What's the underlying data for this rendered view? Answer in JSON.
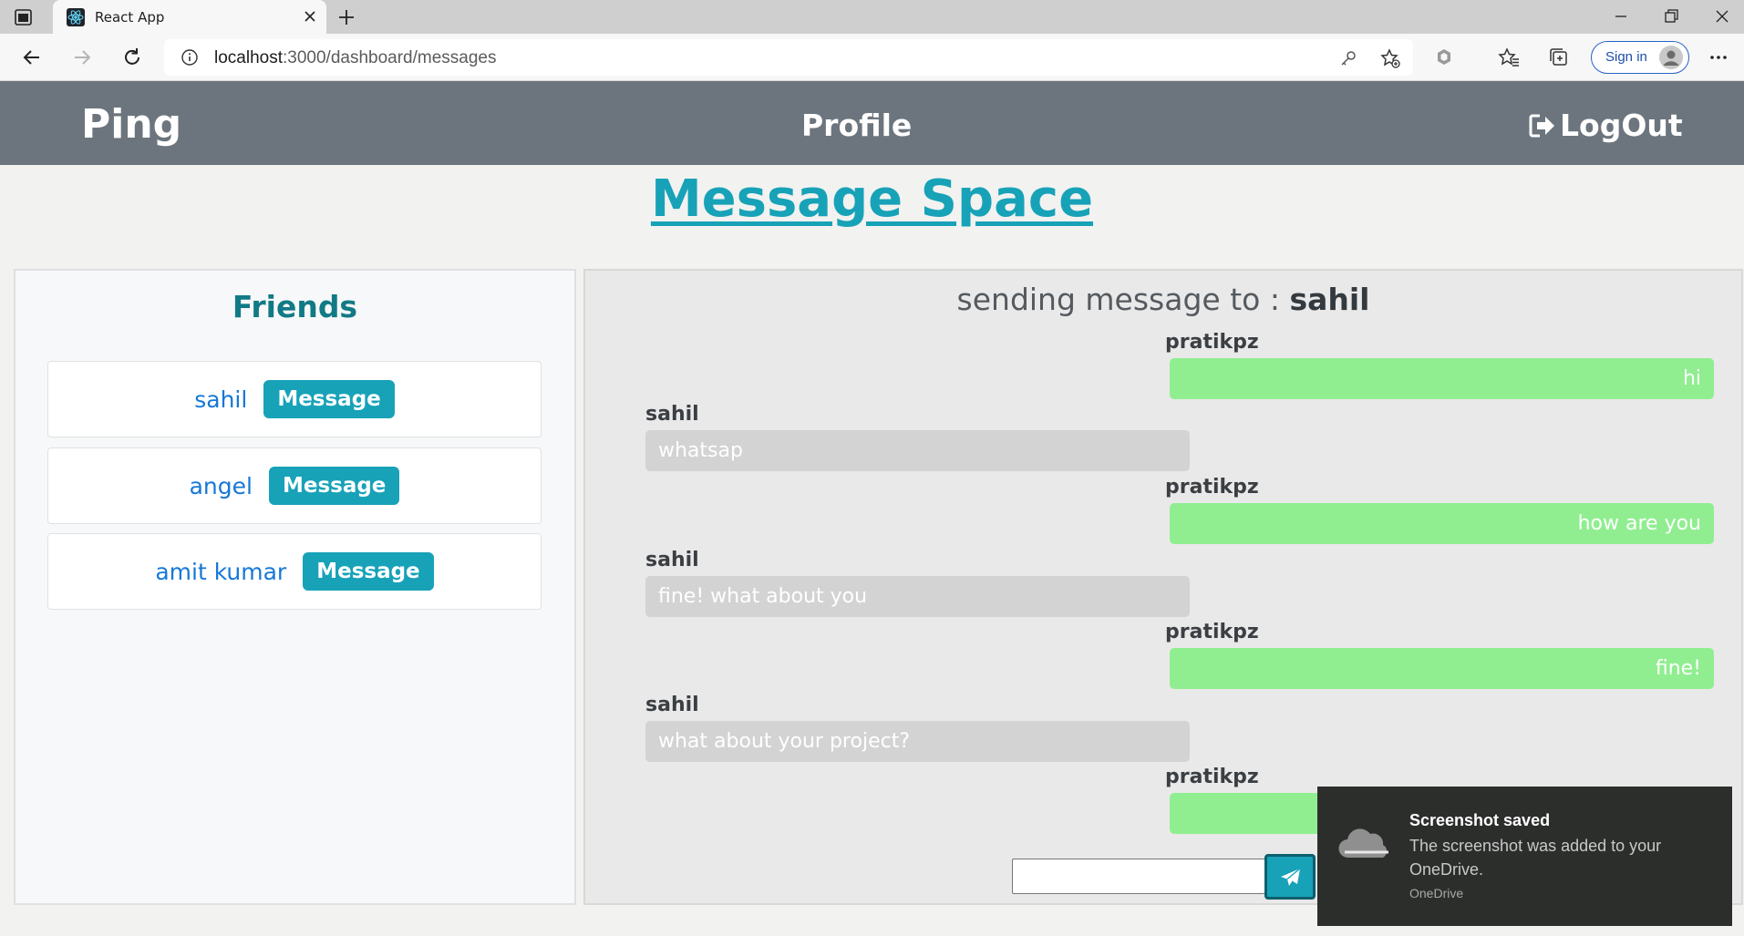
{
  "browser": {
    "tab_title": "React App",
    "url_host": "localhost",
    "url_path": ":3000/dashboard/messages",
    "signin_label": "Sign in"
  },
  "navbar": {
    "brand": "Ping",
    "profile": "Profile",
    "logout": "LogOut"
  },
  "page_title": "Message Space",
  "friends": {
    "title": "Friends",
    "button_label": "Message",
    "items": [
      {
        "name": "sahil"
      },
      {
        "name": "angel"
      },
      {
        "name": "amit kumar"
      }
    ]
  },
  "chat": {
    "prefix": "sending message to : ",
    "recipient": "sahil",
    "messages": [
      {
        "sender": "pratikpz",
        "text": "hi",
        "direction": "out"
      },
      {
        "sender": "sahil",
        "text": "whatsap",
        "direction": "in"
      },
      {
        "sender": "pratikpz",
        "text": "how are you",
        "direction": "out"
      },
      {
        "sender": "sahil",
        "text": "fine! what about you",
        "direction": "in"
      },
      {
        "sender": "pratikpz",
        "text": "fine!",
        "direction": "out"
      },
      {
        "sender": "sahil",
        "text": "what about your project?",
        "direction": "in"
      },
      {
        "sender": "pratikpz",
        "text": "",
        "direction": "out"
      }
    ],
    "input_value": ""
  },
  "toast": {
    "title": "Screenshot saved",
    "body": "The screenshot was added to your OneDrive.",
    "source": "OneDrive"
  },
  "colors": {
    "navbar": "#6c757d",
    "accent": "#17a2b8",
    "outgoing_bubble": "#90ee90",
    "incoming_bubble": "#d3d3d3",
    "friend_name": "#1678d6"
  },
  "icons": [
    "tab-actions-icon",
    "react-logo-icon",
    "close-icon",
    "plus-icon",
    "minimize-icon",
    "restore-icon",
    "window-close-icon",
    "back-arrow-icon",
    "forward-arrow-icon",
    "refresh-icon",
    "info-icon",
    "key-icon",
    "star-add-icon",
    "extension-icon",
    "favorites-icon",
    "collections-icon",
    "user-avatar-icon",
    "more-icon",
    "logout-icon",
    "send-icon",
    "cloud-icon"
  ]
}
